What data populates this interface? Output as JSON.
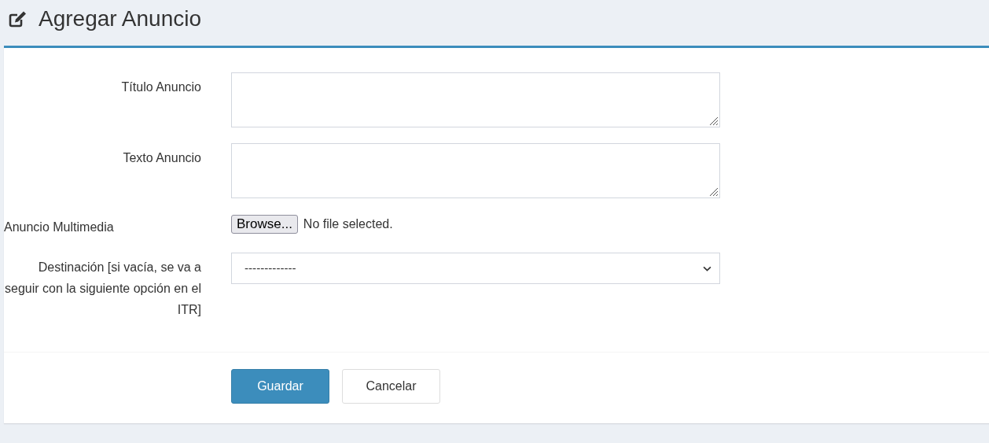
{
  "page_title": "Agregar Anuncio",
  "fields": [
    {
      "kind": "textarea",
      "label": "Título Anuncio"
    },
    {
      "kind": "textarea",
      "label": "Texto Anuncio"
    },
    {
      "kind": "file",
      "label": "Anuncio Multimedia",
      "button": "Browse...",
      "status": "No file selected."
    },
    {
      "kind": "select",
      "label": "Destinación [si vacía, se va a seguir con la siguiente opción en el ITR]",
      "value": "-------------"
    }
  ],
  "buttons": [
    {
      "kind": "primary",
      "label": "Guardar"
    },
    {
      "kind": "default",
      "label": "Cancelar"
    }
  ]
}
